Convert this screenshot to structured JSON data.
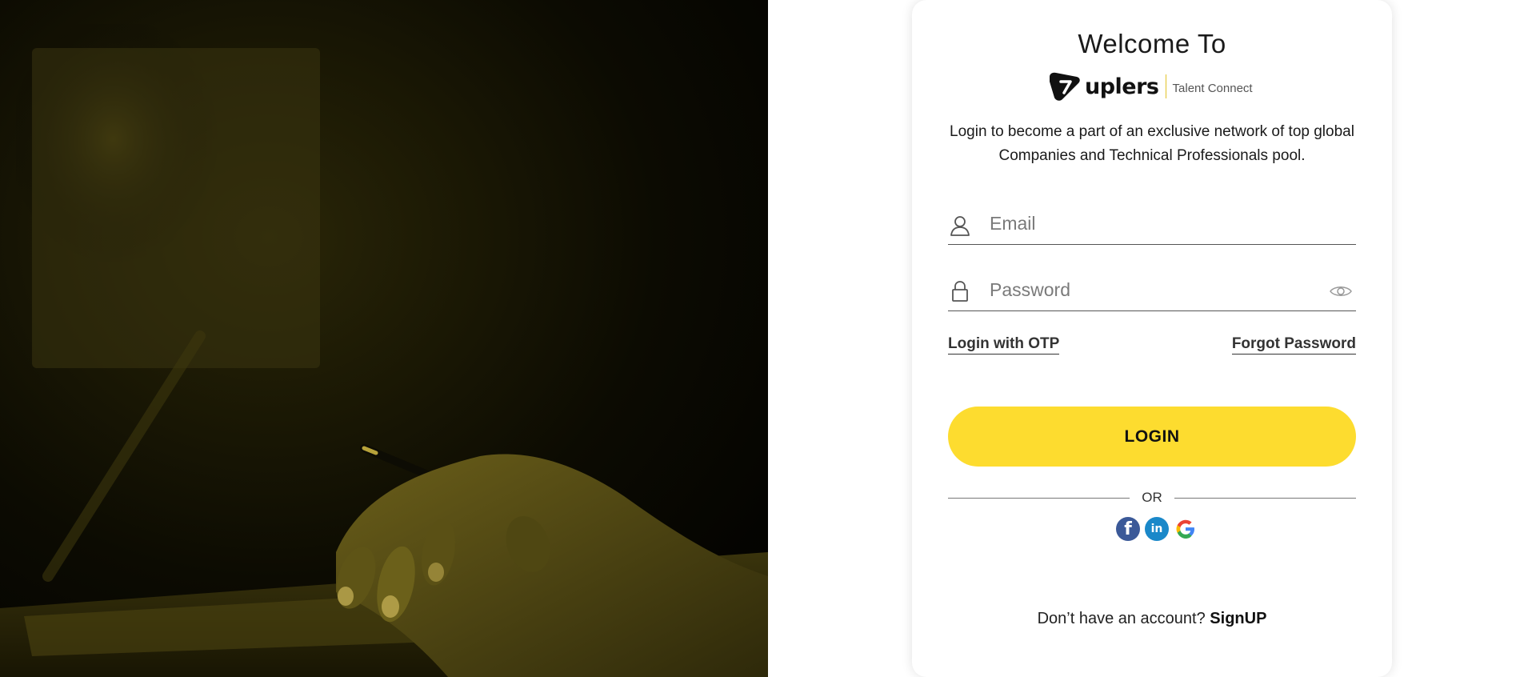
{
  "card": {
    "welcome": "Welcome To",
    "brand": {
      "name": "uplers",
      "tagline": "Talent Connect"
    },
    "intro": "Login to become a part of an exclusive network of top global Companies and Technical Professionals pool.",
    "email": {
      "placeholder": "Email",
      "value": "",
      "icon": "user-icon"
    },
    "password": {
      "placeholder": "Password",
      "value": "",
      "icon": "lock-icon",
      "toggle_icon": "eye-icon"
    },
    "links": {
      "otp": "Login with OTP",
      "forgot": "Forgot Password"
    },
    "login_label": "LOGIN",
    "or_label": "OR",
    "socials": [
      "facebook-icon",
      "linkedin-icon",
      "google-icon"
    ],
    "signup": {
      "prompt": "Don’t have an account?",
      "link": "SignUP"
    }
  },
  "colors": {
    "accent": "#fddc2f",
    "hero_tint": "#2a2607",
    "facebook": "#3b5998",
    "linkedin": "#1a88c9"
  }
}
